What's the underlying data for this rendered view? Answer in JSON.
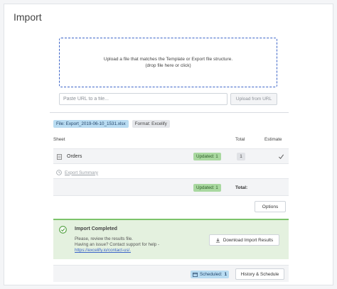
{
  "title": "Import",
  "dropzone": {
    "line1": "Upload a file that matches the Template or Export file structure.",
    "line2": "(drop file here or click)"
  },
  "url": {
    "placeholder": "Paste URL to a file...",
    "button_label": "Upload from URL"
  },
  "file": {
    "name_label": "File: Export_2019-06-10_1531.xlsx",
    "format_label": "Format: Excelify"
  },
  "table": {
    "columns": [
      "Sheet",
      "Total",
      "Estimate"
    ],
    "rows": [
      {
        "sheet": "Orders",
        "status": "Updated: 1",
        "total": "1",
        "estimate_icon": "check-icon"
      }
    ]
  },
  "summary_link": "Export Summary",
  "totals": {
    "status": "Updated: 1",
    "label": "Total:"
  },
  "options_label": "Options",
  "completed": {
    "title": "Import Completed",
    "line1": "Please, review the results file.",
    "line2": "Having an issue? Contact support for help -",
    "link": "https://excelify.io/contact-us/.",
    "download_label": "Download Import Results"
  },
  "schedule": {
    "label": "Scheduled:",
    "count": "1",
    "button_label": "History & Schedule"
  },
  "colors": {
    "accent_blue": "#3b64c8",
    "success_green": "#7cc36a",
    "success_bg": "#e4f1df",
    "badge_blue": "#b9dcf2"
  }
}
